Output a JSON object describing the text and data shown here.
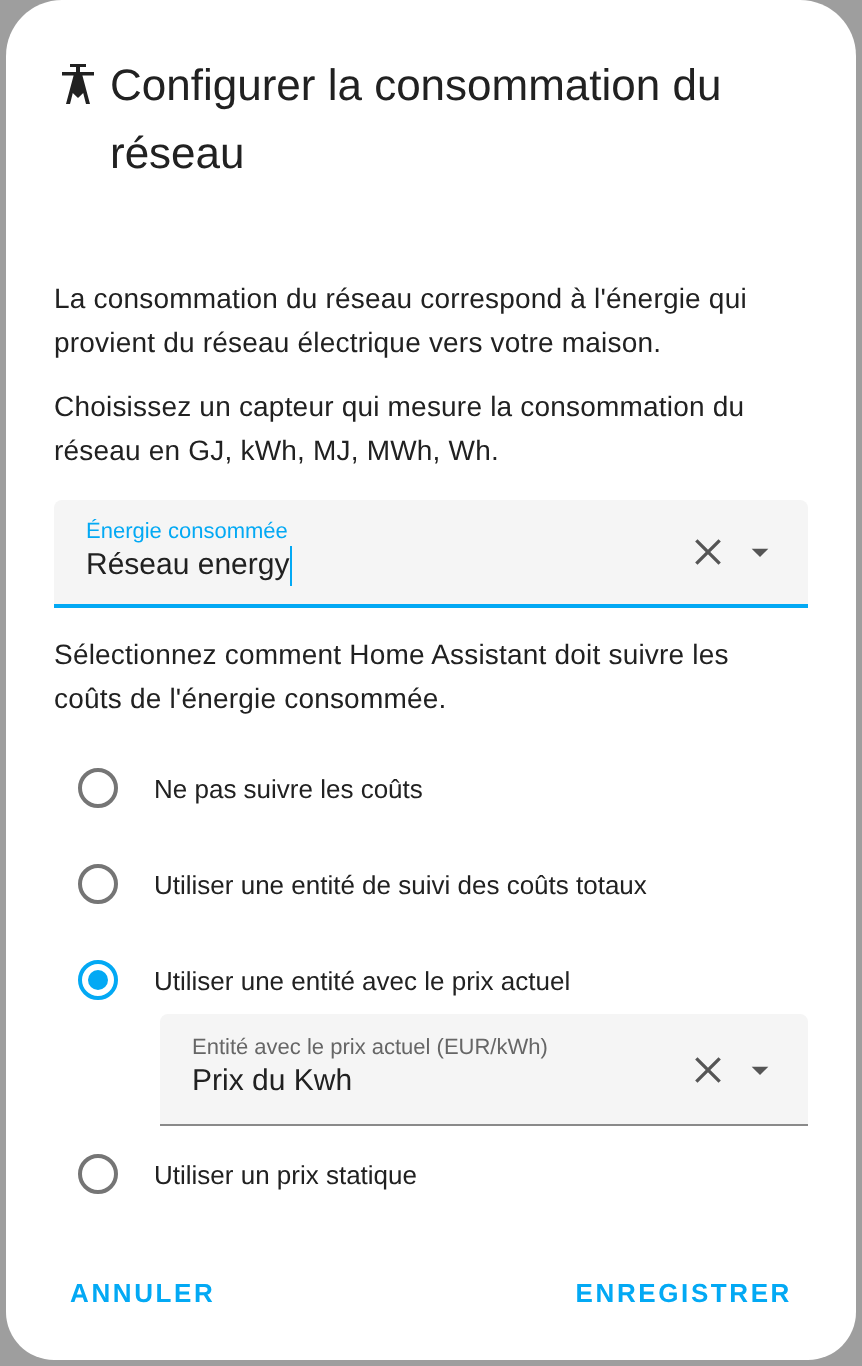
{
  "dialog": {
    "title": "Configurer la consommation du réseau",
    "paragraphs": [
      "La consommation du réseau correspond à l'énergie qui provient du réseau électrique vers votre maison.",
      "Choisissez un capteur qui mesure la consommation du réseau en GJ, kWh, MJ, MWh, Wh."
    ],
    "sensor_field": {
      "label": "Énergie consommée",
      "value": "Réseau energy",
      "focused": true
    },
    "cost_prompt": "Sélectionnez comment Home Assistant doit suivre les coûts de l'énergie consommée.",
    "cost_options": [
      {
        "label": "Ne pas suivre les coûts",
        "selected": false
      },
      {
        "label": "Utiliser une entité de suivi des coûts totaux",
        "selected": false
      },
      {
        "label": "Utiliser une entité avec le prix actuel",
        "selected": true,
        "field": {
          "label": "Entité avec le prix actuel (EUR/kWh)",
          "value": "Prix du Kwh",
          "focused": false
        }
      },
      {
        "label": "Utiliser un prix statique",
        "selected": false
      }
    ],
    "buttons": [
      "ANNULER",
      "ENREGISTRER"
    ]
  }
}
